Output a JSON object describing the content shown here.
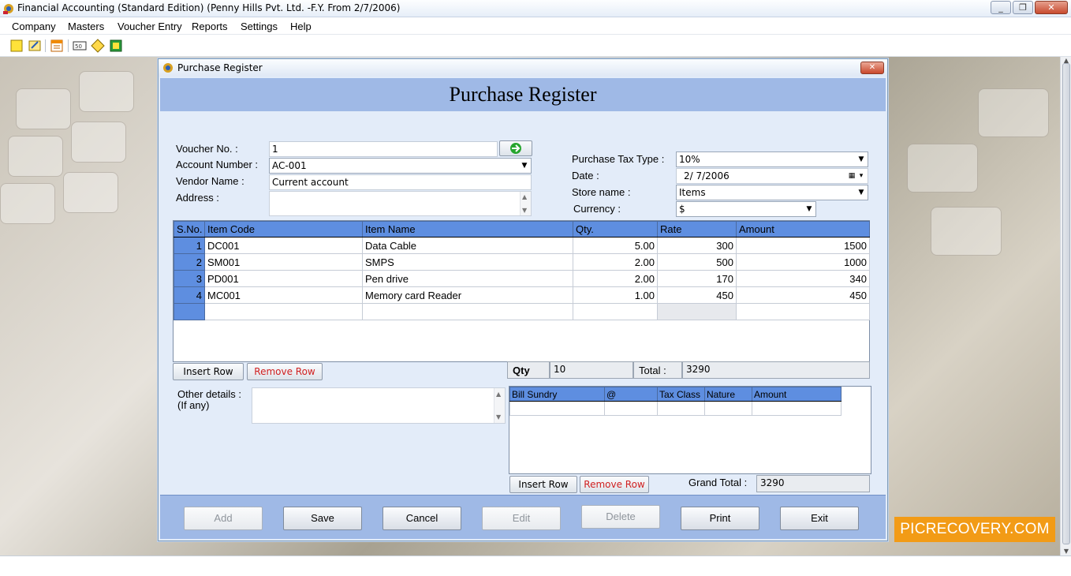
{
  "app": {
    "title": "Financial Accounting (Standard Edition) (Penny Hills Pvt. Ltd. -F.Y. From 2/7/2006)",
    "window_buttons": [
      "minimize",
      "restore",
      "close"
    ]
  },
  "menu": [
    "Company",
    "Masters",
    "Voucher Entry",
    "Reports",
    "Settings",
    "Help"
  ],
  "toolbar_icons": [
    "new-icon",
    "edit-icon",
    "calendar-icon",
    "voucher-icon",
    "diamond-icon",
    "export-icon"
  ],
  "dialog": {
    "title": "Purchase Register",
    "heading": "Purchase Register",
    "close_label": "✕"
  },
  "form": {
    "voucher_no": {
      "label": "Voucher No. :",
      "value": "1"
    },
    "account_number": {
      "label": "Account Number :",
      "value": "AC-001"
    },
    "vendor_name": {
      "label": "Vendor Name :",
      "value": "Current account"
    },
    "address": {
      "label": "Address :",
      "value": ""
    },
    "purchase_tax_type": {
      "label": "Purchase Tax Type :",
      "value": "10%"
    },
    "date": {
      "label": "Date :",
      "value": "2/  7/2006"
    },
    "store_name": {
      "label": "Store name :",
      "value": "Items"
    },
    "currency": {
      "label": "Currency :",
      "value": "$"
    }
  },
  "items_table": {
    "columns": [
      "S.No.",
      "Item Code",
      "Item Name",
      "Qty.",
      "Rate",
      "Amount"
    ],
    "rows": [
      {
        "sno": "1",
        "code": "DC001",
        "name": "Data Cable",
        "qty": "5.00",
        "rate": "300",
        "amount": "1500"
      },
      {
        "sno": "2",
        "code": "SM001",
        "name": "SMPS",
        "qty": "2.00",
        "rate": "500",
        "amount": "1000"
      },
      {
        "sno": "3",
        "code": "PD001",
        "name": "Pen drive",
        "qty": "2.00",
        "rate": "170",
        "amount": "340"
      },
      {
        "sno": "4",
        "code": "MC001",
        "name": "Memory card Reader",
        "qty": "1.00",
        "rate": "450",
        "amount": "450"
      }
    ]
  },
  "grid_buttons": {
    "insert_row": "Insert Row",
    "remove_row": "Remove Row"
  },
  "totals": {
    "qty_label": "Qty",
    "qty_value": "10",
    "total_label": "Total :",
    "total_value": "3290"
  },
  "other_details": {
    "label_line1": "Other details :",
    "label_line2": "(If any)",
    "value": ""
  },
  "sundry_table": {
    "columns": [
      "Bill Sundry",
      "@",
      "Tax Class",
      "Nature",
      "Amount"
    ]
  },
  "sundry_buttons": {
    "insert_row": "Insert Row",
    "remove_row": "Remove Row"
  },
  "grand_total": {
    "label": "Grand Total :",
    "value": "3290"
  },
  "actions": {
    "add": "Add",
    "save": "Save",
    "cancel": "Cancel",
    "edit": "Edit",
    "delete": "Delete",
    "print": "Print",
    "exit": "Exit"
  },
  "watermark": "PICRECOVERY.COM",
  "colors": {
    "header_blue": "#9fb9e6",
    "grid_header": "#5e8ee0",
    "remove_red": "#d02020",
    "watermark_orange": "#f29b16"
  }
}
